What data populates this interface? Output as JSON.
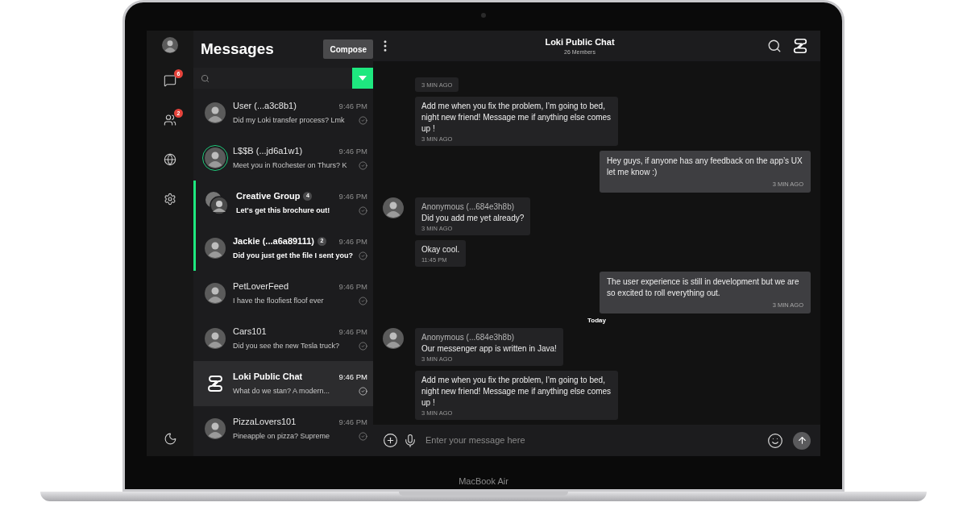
{
  "rail": {
    "items": [
      {
        "kind": "chats",
        "badge": "6"
      },
      {
        "kind": "contacts",
        "badge": "2"
      },
      {
        "kind": "globe"
      },
      {
        "kind": "settings"
      }
    ],
    "bottom": {
      "kind": "moon"
    }
  },
  "list": {
    "title": "Messages",
    "compose": "Compose",
    "conversations": [
      {
        "name": "User (...a3c8b1)",
        "time": "9:46 PM",
        "preview": "Did my Loki transfer process? Lmk",
        "kind": "photo",
        "ring": false,
        "unread": false,
        "selected": false
      },
      {
        "name": "L$$B (...jd6a1w1)",
        "time": "9:46 PM",
        "preview": "Meet you in Rochester on Thurs? K",
        "kind": "photo",
        "ring": true,
        "unread": false,
        "selected": false
      },
      {
        "name": "Creative Group",
        "count": "4",
        "time": "9:46 PM",
        "preview": "Let's get this brochure out!",
        "kind": "group",
        "ring": false,
        "unread": true,
        "selected": false
      },
      {
        "name": "Jackie (...a6a89111)",
        "count": "2",
        "time": "9:46 PM",
        "preview": "Did you just get the file I sent you?",
        "kind": "photo",
        "ring": false,
        "unread": true,
        "selected": false
      },
      {
        "name": "PetLoverFeed",
        "time": "9:46 PM",
        "preview": "I have the floofiest floof ever",
        "kind": "photo",
        "ring": false,
        "unread": false,
        "selected": false
      },
      {
        "name": "Cars101",
        "time": "9:46 PM",
        "preview": "Did you see the new Tesla truck?",
        "kind": "photo",
        "ring": false,
        "unread": false,
        "selected": false
      },
      {
        "name": "Loki Public Chat",
        "time": "9:46 PM",
        "preview": "What do we stan? A modern...",
        "kind": "logo",
        "ring": false,
        "unread": false,
        "selected": true
      },
      {
        "name": "PizzaLovers101",
        "time": "9:46 PM",
        "preview": "Pineapple on pizza? Supreme",
        "kind": "photo",
        "ring": false,
        "unread": false,
        "selected": false
      }
    ]
  },
  "chat": {
    "title": "Loki Public Chat",
    "subtitle": "26 Members",
    "messages": [
      {
        "kind": "incoming",
        "time": "3 MIN AGO"
      },
      {
        "kind": "incoming",
        "text": "Add me when you fix the problem, I’m going to bed, night new friend! Message me if anything else comes up !",
        "time": "3 MIN AGO"
      },
      {
        "kind": "outgoing",
        "text": "Hey guys, if anyone has any feedback on the app’s UX let me know :)",
        "time": "3 MIN AGO"
      },
      {
        "kind": "incoming",
        "sender": "Anonymous (...684e3h8b)",
        "text": "Did you add me yet already?",
        "time": "3 MIN AGO"
      },
      {
        "kind": "incoming",
        "text": "Okay cool.",
        "time": "11:45 PM"
      },
      {
        "kind": "outgoing",
        "text": "The user experience is still in development but we are so excited to roll everything out.",
        "time": "3 MIN AGO"
      },
      {
        "kind": "divider",
        "text": "Today"
      },
      {
        "kind": "incoming",
        "sender": "Anonymous (...684e3h8b)",
        "text": "Our messenger app is written in  Java!",
        "time": "3 MIN AGO"
      },
      {
        "kind": "incoming",
        "text": "Add me when you fix the problem, I’m going to bed, night new friend! Message me if anything else comes up !",
        "time": "3 MIN AGO"
      }
    ],
    "composer": {
      "placeholder": "Enter your message here"
    }
  },
  "device": {
    "label": "MacBook Air"
  }
}
